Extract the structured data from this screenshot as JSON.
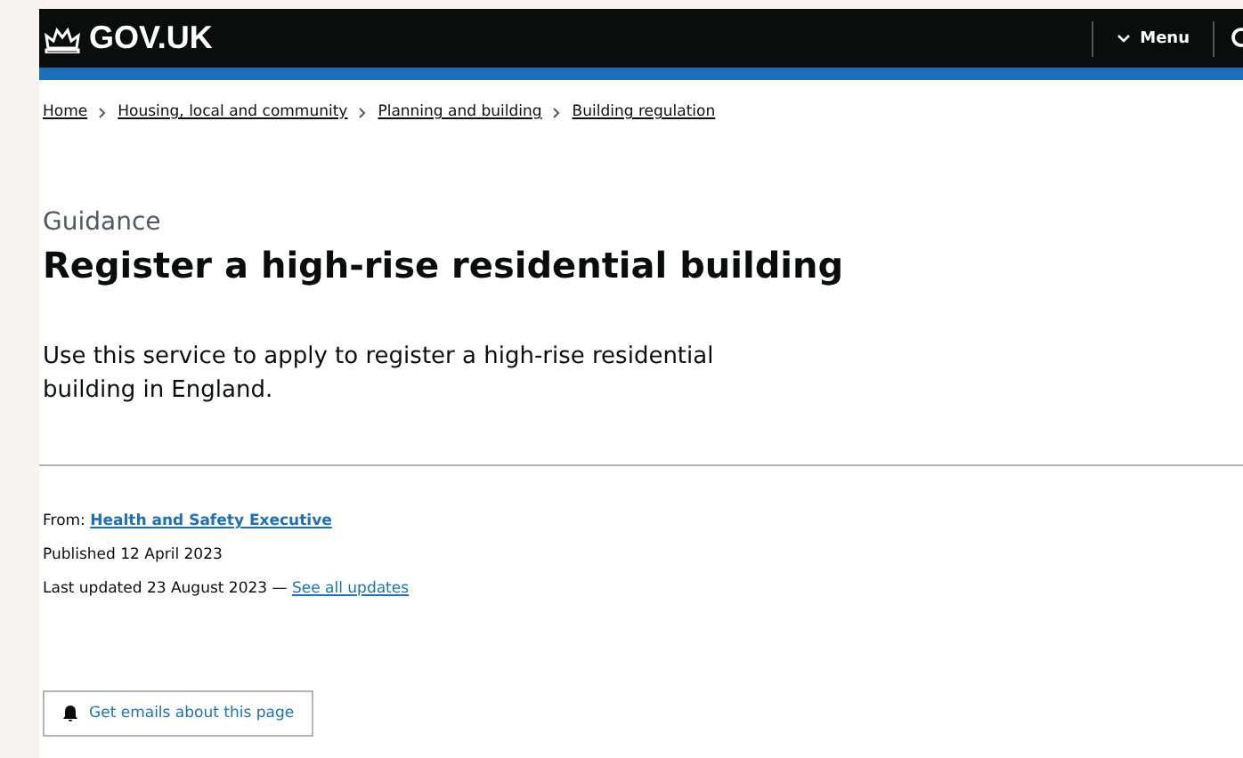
{
  "header": {
    "logo": "GOV.UK",
    "menu": "Menu"
  },
  "breadcrumbs": [
    "Home",
    "Housing, local and community",
    "Planning and building",
    "Building regulation"
  ],
  "caption": "Guidance",
  "title": "Register a high-rise residential building",
  "description": "Use this service to apply to register a high-rise residential building in England.",
  "metadata": {
    "from_label": "From:",
    "from_link": "Health and Safety Executive",
    "published": "Published 12 April 2023",
    "updated": "Last updated 23 August 2023 —",
    "updates_link": "See all updates"
  },
  "email_button": "Get emails about this page"
}
